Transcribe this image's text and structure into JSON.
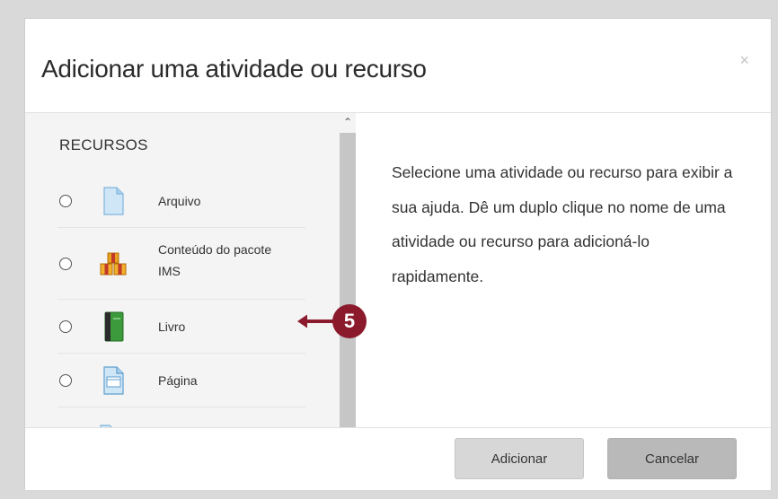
{
  "modal": {
    "title": "Adicionar uma atividade ou recurso",
    "close_glyph": "×"
  },
  "left": {
    "section_label": "RECURSOS",
    "items": [
      {
        "label": "Arquivo",
        "icon": "file-icon"
      },
      {
        "label": "Conteúdo do pacote IMS",
        "icon": "package-boxes-icon"
      },
      {
        "label": "Livro",
        "icon": "book-icon"
      },
      {
        "label": "Página",
        "icon": "page-icon"
      }
    ]
  },
  "right": {
    "help_text": "Selecione uma atividade ou recurso para exibir a sua ajuda. Dê um duplo clique no nome de uma atividade ou recurso para adicioná-lo rapidamente."
  },
  "footer": {
    "add_label": "Adicionar",
    "cancel_label": "Cancelar"
  },
  "callout": {
    "number": "5",
    "color": "#8b1a2c"
  }
}
